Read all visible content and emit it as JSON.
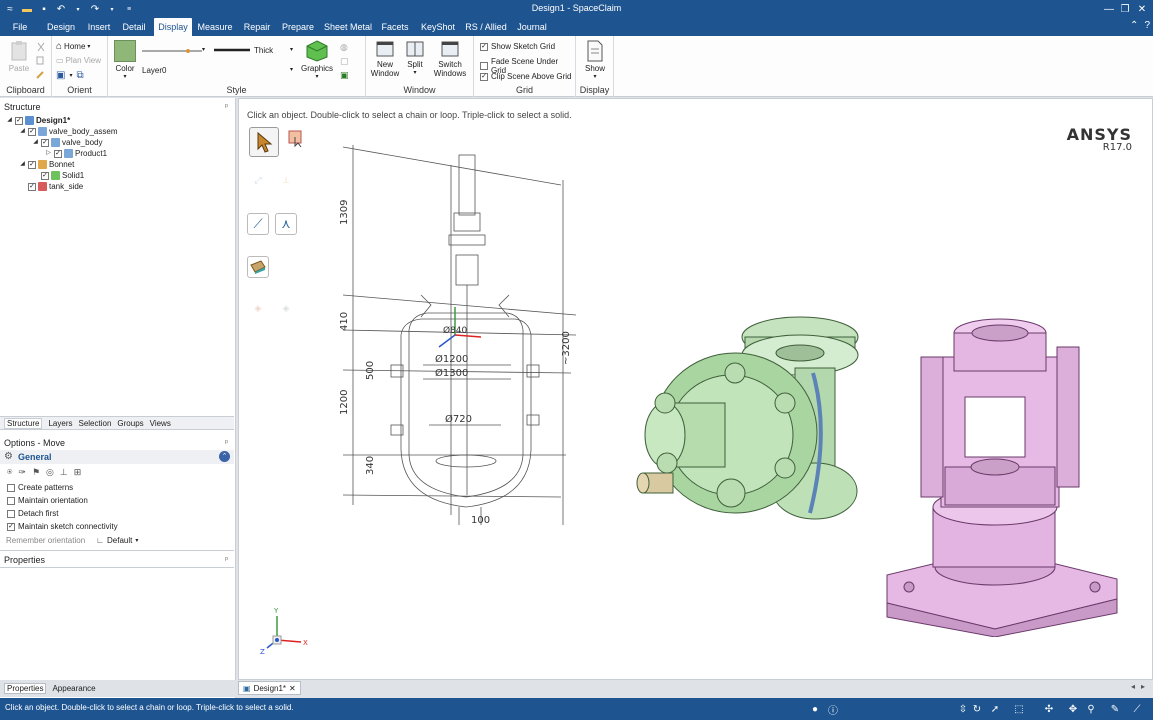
{
  "window": {
    "title": "Design1 - SpaceClaim"
  },
  "menu": {
    "tabs": [
      {
        "label": "File",
        "active": false
      },
      {
        "label": "Design",
        "active": false
      },
      {
        "label": "Insert",
        "active": false
      },
      {
        "label": "Detail",
        "active": false
      },
      {
        "label": "Display",
        "active": true
      },
      {
        "label": "Measure",
        "active": false
      },
      {
        "label": "Repair",
        "active": false
      },
      {
        "label": "Prepare",
        "active": false
      },
      {
        "label": "Sheet Metal",
        "active": false
      },
      {
        "label": "Facets",
        "active": false
      },
      {
        "label": "KeyShot",
        "active": false
      },
      {
        "label": "RS / Allied",
        "active": false
      },
      {
        "label": "Journal",
        "active": false
      }
    ]
  },
  "ribbon": {
    "clipboard": {
      "label": "Clipboard",
      "paste": "Paste"
    },
    "orient": {
      "label": "Orient",
      "home": "Home",
      "plan_view": "Plan View"
    },
    "style": {
      "label": "Style",
      "color": "Color",
      "layer": "Layer0",
      "line_weight": "Thick",
      "graphics": "Graphics"
    },
    "window": {
      "label": "Window",
      "new_window": "New Window",
      "split": "Split",
      "switch_windows": "Switch Windows"
    },
    "grid": {
      "label": "Grid",
      "show_sketch_grid": "Show Sketch Grid",
      "fade_scene": "Fade Scene Under Grid",
      "clip_scene": "Clip Scene Above Grid"
    },
    "display": {
      "label": "Display",
      "show": "Show"
    }
  },
  "structure": {
    "title": "Structure",
    "tree": [
      {
        "label": "Design1*",
        "bold": true
      },
      {
        "label": "valve_body_assem"
      },
      {
        "label": "valve_body"
      },
      {
        "label": "Product1"
      },
      {
        "label": "Bonnet"
      },
      {
        "label": "Solid1"
      },
      {
        "label": "tank_side"
      }
    ],
    "tabs": [
      "Structure",
      "Layers",
      "Selection",
      "Groups",
      "Views"
    ]
  },
  "options": {
    "title": "Options - Move",
    "section": "General",
    "items": [
      {
        "label": "Create patterns",
        "checked": false
      },
      {
        "label": "Maintain orientation",
        "checked": false
      },
      {
        "label": "Detach first",
        "checked": false
      },
      {
        "label": "Maintain sketch connectivity",
        "checked": true
      }
    ],
    "remember_label": "Remember orientation",
    "remember_value": "Default"
  },
  "properties": {
    "title": "Properties",
    "tabs": [
      "Properties",
      "Appearance"
    ]
  },
  "viewport": {
    "hint": "Click an object.  Double-click to select a chain or loop.  Triple-click to select a solid.",
    "brand": "ANSYS",
    "version": "R17.0",
    "drawing_dims": [
      "1309",
      "410",
      "500",
      "1200",
      "340",
      "Ø1200",
      "Ø1300",
      "Ø720",
      "~3200",
      "100",
      "Ø840"
    ],
    "triad": {
      "x": "X",
      "y": "Y",
      "z": "Z"
    }
  },
  "doc_tab": {
    "label": "Design1*"
  },
  "status": {
    "message": "Click an object.  Double-click to select a chain or loop.  Triple-click to select a solid."
  },
  "colors": {
    "brand_blue": "#1e5591",
    "green_part": "#b9e0b3",
    "pink_part": "#e8b8e6"
  }
}
